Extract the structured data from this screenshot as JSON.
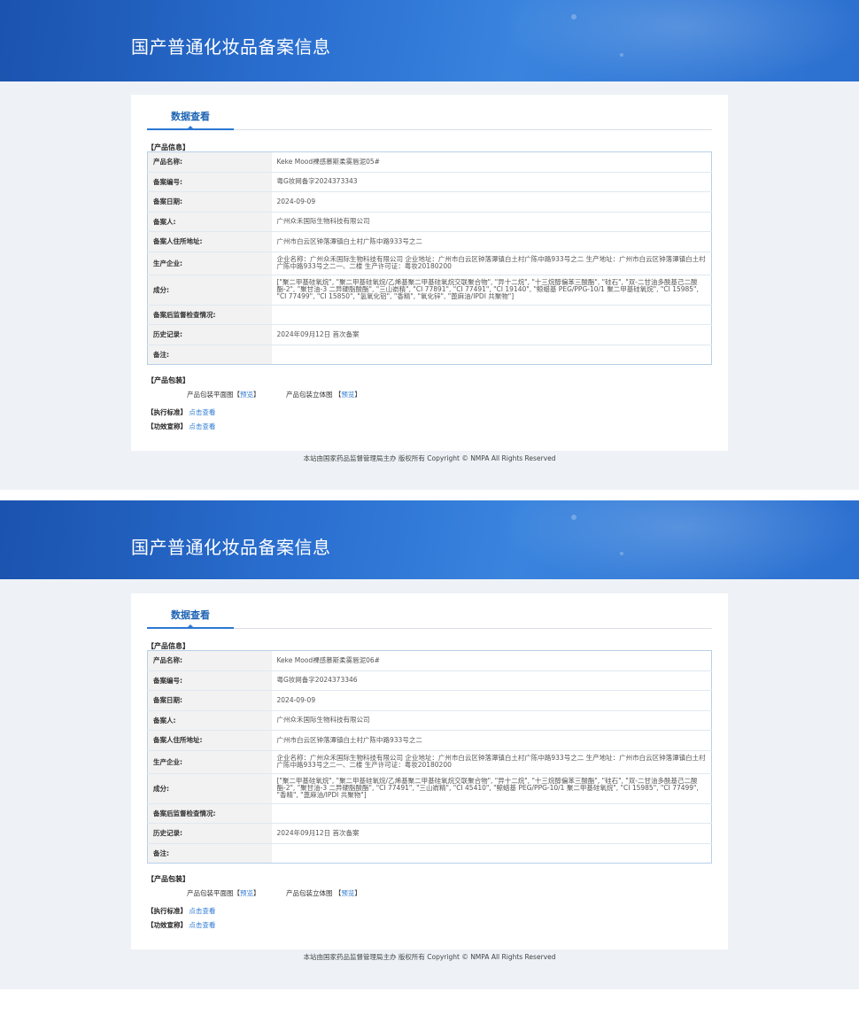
{
  "header": {
    "title": "国产普通化妆品备案信息"
  },
  "tab": {
    "label": "数据查看"
  },
  "labels": {
    "section_info": "【产品信息】",
    "name": "产品名称:",
    "record_no": "备案编号:",
    "record_date": "备案日期:",
    "applicant": "备案人:",
    "applicant_addr": "备案人住所地址:",
    "manufacturer": "生产企业:",
    "ingredients": "成分:",
    "inspection": "备案后监督检查情况:",
    "history": "历史记录:",
    "remarks": "备注:",
    "section_pack": "【产品包装】",
    "pack_flat": "产品包装平面图",
    "pack_3d": "产品包装立体图",
    "preview": "预览",
    "bracket_open": "【",
    "bracket_close": "】",
    "exec_std": "【执行标准】",
    "efficacy": "【功效宣称】",
    "click_view": "点击查看"
  },
  "footer": {
    "text": "本站由国家药品监督管理局主办 版权所有 Copyright © NMPA All Rights Reserved"
  },
  "records": [
    {
      "name": "Keke Mood裸感慕斯柔雾唇泥05#",
      "record_no": "粤G妆网备字2024373343",
      "record_date": "2024-09-09",
      "applicant": "广州众禾国际生物科技有限公司",
      "applicant_addr": "广州市白云区钟落潭镇白土村广陈中路933号之二",
      "manufacturer": "企业名称：广州众禾国际生物科技有限公司 企业地址：广州市白云区钟落潭镇白土村广陈中路933号之二 生产地址：广州市白云区钟落潭镇白土村广陈中路933号之二一、二楼 生产许可证：粤妆20180200",
      "ingredients": "[\"聚二甲基硅氧烷\", \"聚二甲基硅氧烷/乙烯基聚二甲基硅氧烷交联聚合物\", \"异十二烷\", \"十三烷醇偏苯三酸酯\", \"硅石\", \"双-二甘油多酰基己二酸酯-2\", \"聚甘油-3 二异硬脂酸酯\", \"三山嵛精\", \"CI 77891\", \"CI 77491\", \"CI 19140\", \"鲸蜡基 PEG/PPG-10/1 聚二甲基硅氧烷\", \"CI 15985\", \"CI 77499\", \"CI 15850\", \"氢氧化铝\", \"香精\", \"氧化锌\", \"蓖麻油/IPDI 共聚物\"]",
      "inspection": "",
      "history": "2024年09月12日 首次备案",
      "remarks": ""
    },
    {
      "name": "Keke Mood裸感慕斯柔雾唇泥06#",
      "record_no": "粤G妆网备字2024373346",
      "record_date": "2024-09-09",
      "applicant": "广州众禾国际生物科技有限公司",
      "applicant_addr": "广州市白云区钟落潭镇白土村广陈中路933号之二",
      "manufacturer": "企业名称：广州众禾国际生物科技有限公司 企业地址：广州市白云区钟落潭镇白土村广陈中路933号之二 生产地址：广州市白云区钟落潭镇白土村广陈中路933号之二一、二楼 生产许可证：粤妆20180200",
      "ingredients": "[\"聚二甲基硅氧烷\", \"聚二甲基硅氧烷/乙烯基聚二甲基硅氧烷交联聚合物\", \"异十二烷\", \"十三烷醇偏苯三酸酯\", \"硅石\", \"双-二甘油多酰基己二酸酯-2\", \"聚甘油-3 二异硬脂酸酯\", \"CI 77491\", \"三山嵛精\", \"CI 45410\", \"鲸蜡基 PEG/PPG-10/1 聚二甲基硅氧烷\", \"CI 15985\", \"CI 77499\", \"香精\", \"蓖麻油/IPDI 共聚物\"]",
      "inspection": "",
      "history": "2024年09月12日 首次备案",
      "remarks": ""
    }
  ]
}
